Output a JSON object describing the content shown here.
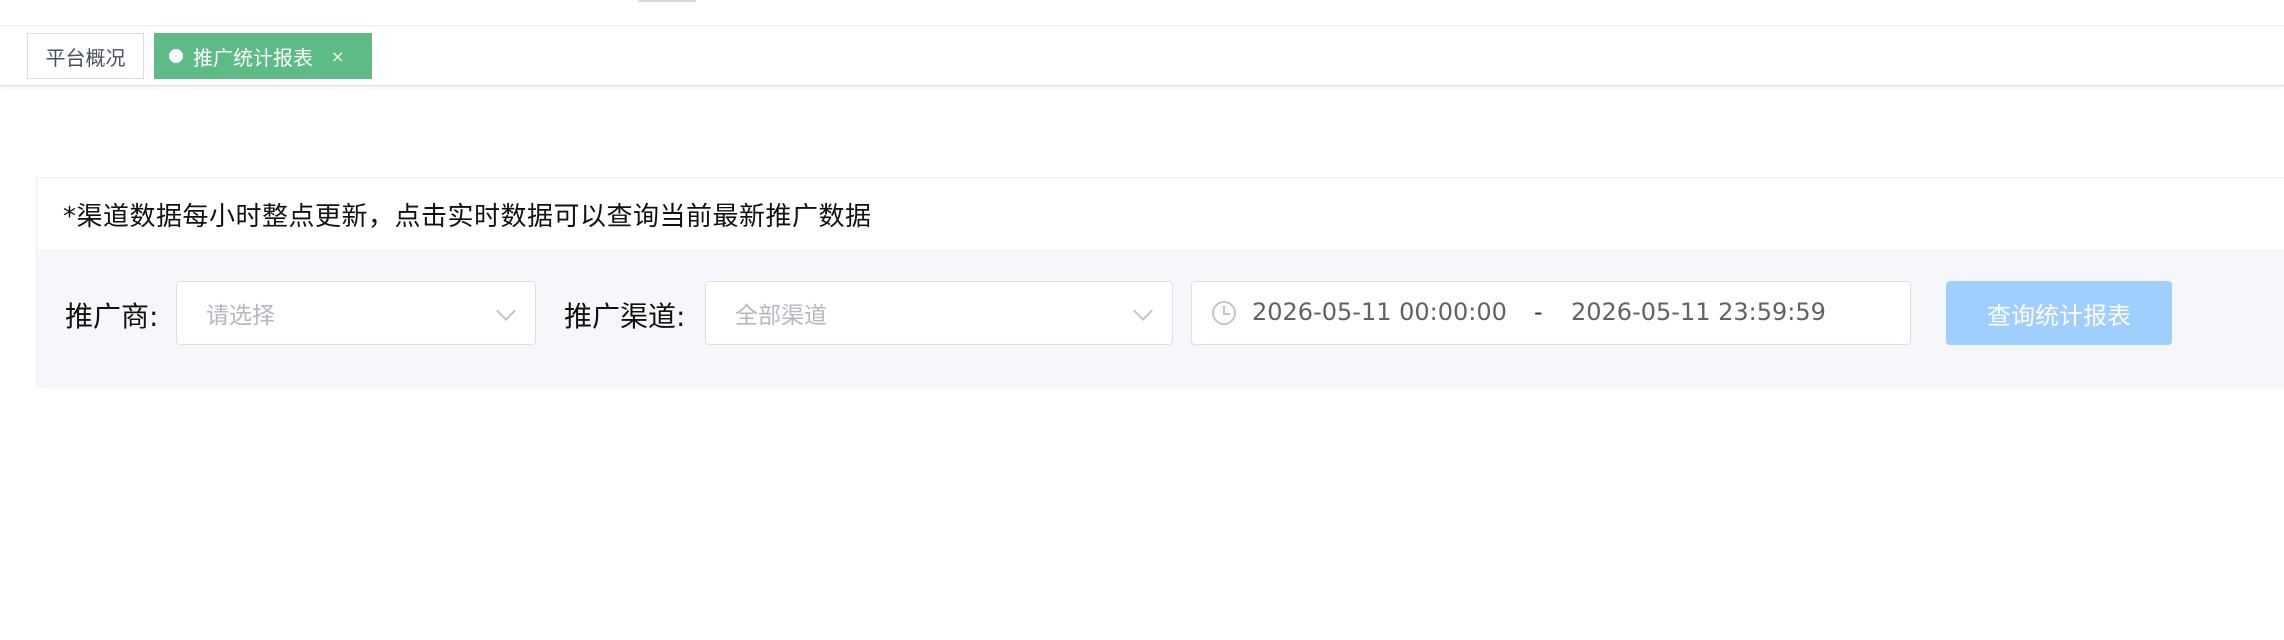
{
  "tags": {
    "home_label": "平台概况",
    "active_label": "推广统计报表",
    "close_symbol": "×"
  },
  "notice": "*渠道数据每小时整点更新，点击实时数据可以查询当前最新推广数据",
  "filters": {
    "merchant_label": "推广商:",
    "merchant_placeholder": "请选择",
    "channel_label": "推广渠道:",
    "channel_placeholder": "全部渠道",
    "date_start": "2026-05-11 00:00:00",
    "date_separator": "-",
    "date_end": "2026-05-11 23:59:59",
    "query_button": "查询统计报表"
  },
  "colors": {
    "active_tag": "#5dbb86",
    "query_button_disabled": "#a0cfff"
  }
}
